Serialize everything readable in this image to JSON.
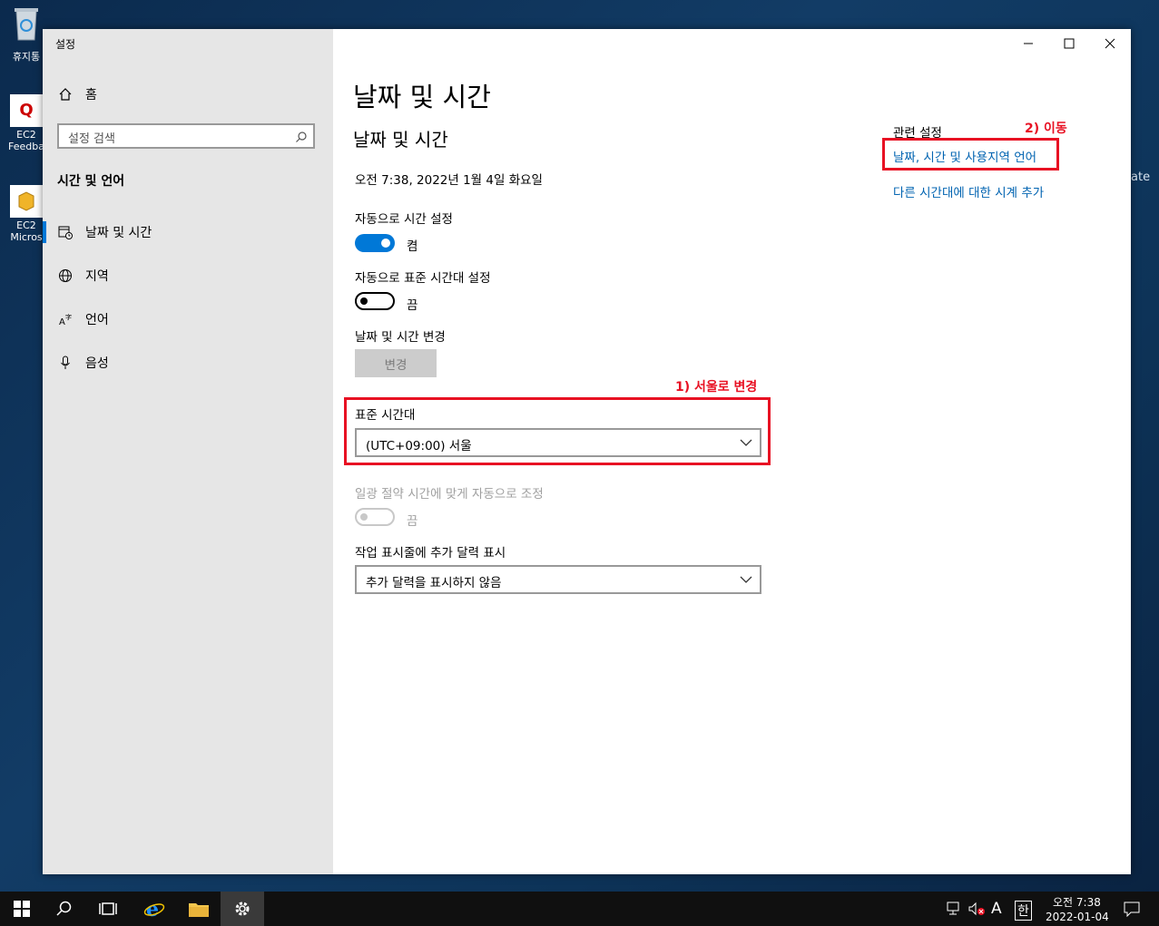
{
  "desktop": {
    "icons": [
      {
        "label": "휴지통"
      },
      {
        "label": "EC2 Feedba"
      },
      {
        "label": "EC2 Micros"
      }
    ],
    "side_text": "ate"
  },
  "window": {
    "title": "설정",
    "controls": {
      "minimize": "minimize",
      "maximize": "maximize",
      "close": "close"
    }
  },
  "sidebar": {
    "home_label": "홈",
    "search_placeholder": "설정 검색",
    "section_title": "시간 및 언어",
    "items": [
      {
        "label": "날짜 및 시간",
        "icon": "calendar-clock-icon",
        "active": true
      },
      {
        "label": "지역",
        "icon": "globe-icon"
      },
      {
        "label": "언어",
        "icon": "language-icon"
      },
      {
        "label": "음성",
        "icon": "microphone-icon"
      }
    ]
  },
  "main": {
    "page_title": "날짜 및 시간",
    "section_title": "날짜 및 시간",
    "current_datetime": "오전 7:38, 2022년 1월 4일 화요일",
    "auto_time": {
      "label": "자동으로 시간 설정",
      "state": "켬"
    },
    "auto_timezone": {
      "label": "자동으로 표준 시간대 설정",
      "state": "끔"
    },
    "change_datetime": {
      "label": "날짜 및 시간 변경",
      "button": "변경"
    },
    "timezone": {
      "label": "표준 시간대",
      "value": "(UTC+09:00) 서울"
    },
    "dst": {
      "label": "일광 절약 시간에 맞게 자동으로 조정",
      "state": "끔"
    },
    "calendar": {
      "label": "작업 표시줄에 추가 달력 표시",
      "value": "추가 달력을 표시하지 않음"
    }
  },
  "related": {
    "title": "관련 설정",
    "links": [
      "날짜, 시간 및 사용지역 언어",
      "다른 시간대에 대한 시계 추가"
    ]
  },
  "annotations": {
    "step1": "1) 서울로 변경",
    "step2": "2) 이동",
    "color": "#e81123"
  },
  "taskbar": {
    "ime_mode": "A",
    "ime_lang": "한",
    "time": "오전 7:38",
    "date": "2022-01-04"
  },
  "colors": {
    "accent": "#0078d7",
    "link": "#0063b1",
    "sidebar_bg": "#e6e6e6"
  }
}
